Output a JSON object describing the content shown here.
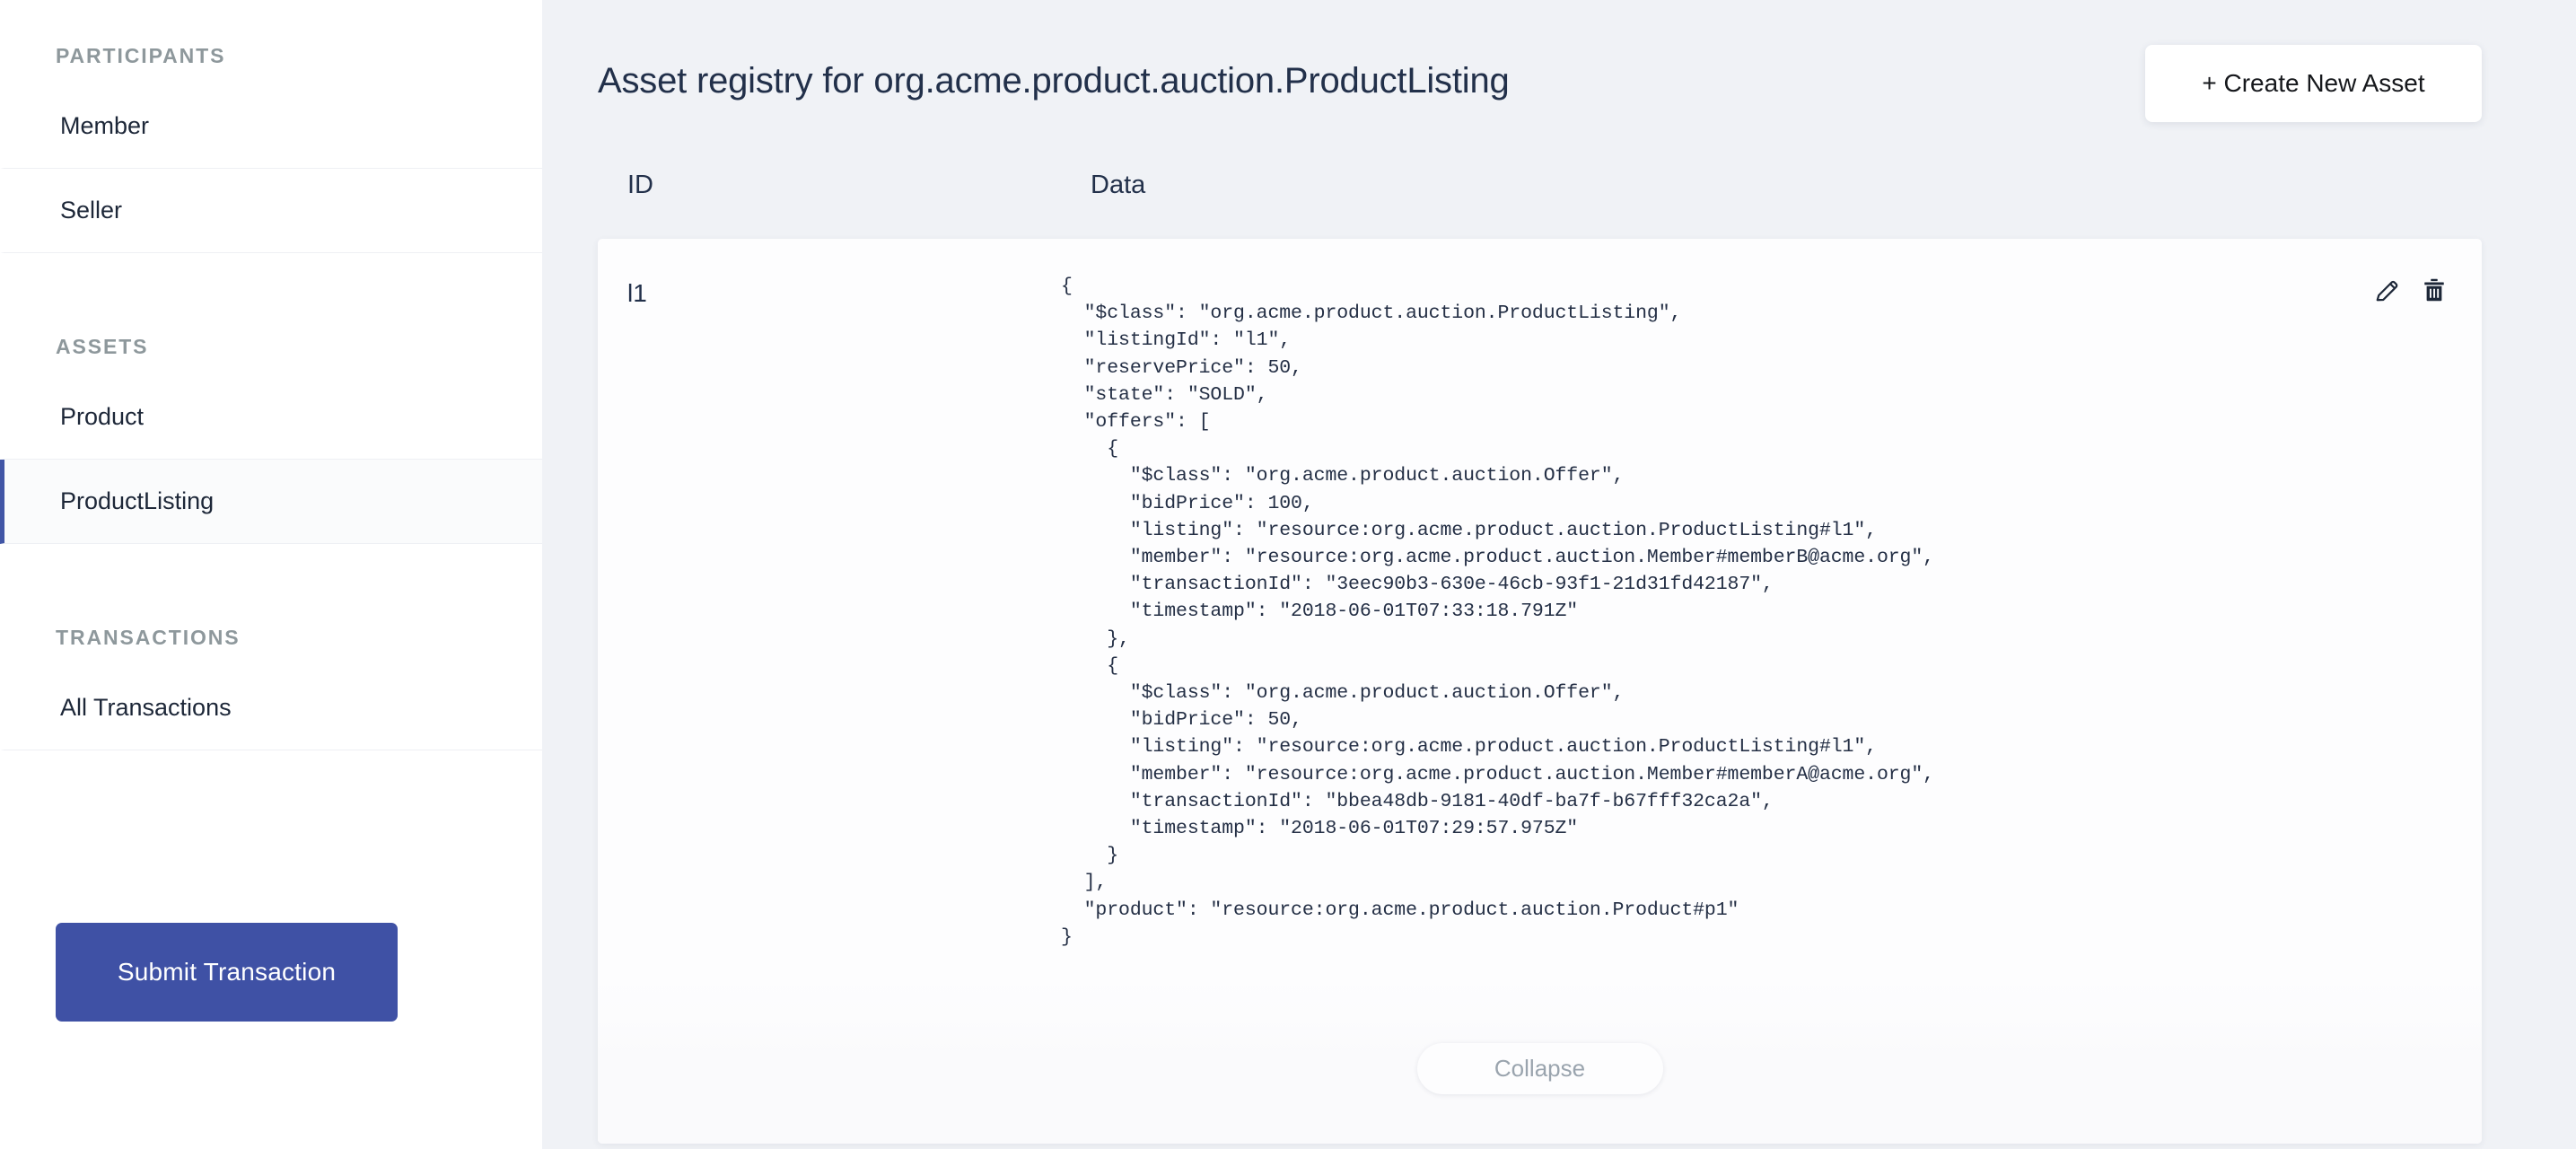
{
  "sidebar": {
    "sections": [
      {
        "label": "PARTICIPANTS",
        "items": [
          {
            "label": "Member",
            "active": false
          },
          {
            "label": "Seller",
            "active": false
          }
        ]
      },
      {
        "label": "ASSETS",
        "items": [
          {
            "label": "Product",
            "active": false
          },
          {
            "label": "ProductListing",
            "active": true
          }
        ]
      },
      {
        "label": "TRANSACTIONS",
        "items": [
          {
            "label": "All Transactions",
            "active": false
          }
        ]
      }
    ],
    "submit_label": "Submit Transaction"
  },
  "header": {
    "title": "Asset registry for org.acme.product.auction.ProductListing",
    "create_label": "+ Create New Asset"
  },
  "table": {
    "columns": {
      "id": "ID",
      "data": "Data"
    },
    "rows": [
      {
        "id": "l1",
        "json": "{\n  \"$class\": \"org.acme.product.auction.ProductListing\",\n  \"listingId\": \"l1\",\n  \"reservePrice\": 50,\n  \"state\": \"SOLD\",\n  \"offers\": [\n    {\n      \"$class\": \"org.acme.product.auction.Offer\",\n      \"bidPrice\": 100,\n      \"listing\": \"resource:org.acme.product.auction.ProductListing#l1\",\n      \"member\": \"resource:org.acme.product.auction.Member#memberB@acme.org\",\n      \"transactionId\": \"3eec90b3-630e-46cb-93f1-21d31fd42187\",\n      \"timestamp\": \"2018-06-01T07:33:18.791Z\"\n    },\n    {\n      \"$class\": \"org.acme.product.auction.Offer\",\n      \"bidPrice\": 50,\n      \"listing\": \"resource:org.acme.product.auction.ProductListing#l1\",\n      \"member\": \"resource:org.acme.product.auction.Member#memberA@acme.org\",\n      \"transactionId\": \"bbea48db-9181-40df-ba7f-b67fff32ca2a\",\n      \"timestamp\": \"2018-06-01T07:29:57.975Z\"\n    }\n  ],\n  \"product\": \"resource:org.acme.product.auction.Product#p1\"\n}",
        "edit_icon": "pencil-icon",
        "delete_icon": "trash-icon"
      }
    ],
    "collapse_label": "Collapse"
  },
  "colors": {
    "accent": "#3f51a5",
    "active_border": "#4156a6",
    "page_bg": "#f0f2f6",
    "text": "#22304a",
    "muted": "#8e989c"
  }
}
